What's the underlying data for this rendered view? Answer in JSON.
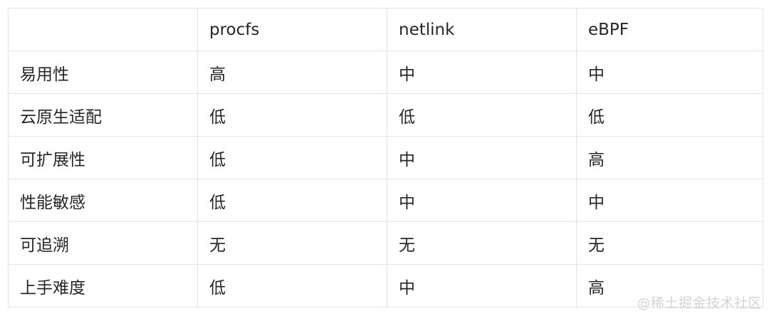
{
  "table": {
    "headers": [
      "",
      "procfs",
      "netlink",
      "eBPF"
    ],
    "rows": [
      {
        "label": "易用性",
        "procfs": "高",
        "netlink": "中",
        "ebpf": "中"
      },
      {
        "label": "云原生适配",
        "procfs": "低",
        "netlink": "低",
        "ebpf": "低"
      },
      {
        "label": "可扩展性",
        "procfs": "低",
        "netlink": "中",
        "ebpf": "高"
      },
      {
        "label": "性能敏感",
        "procfs": "低",
        "netlink": "中",
        "ebpf": "中"
      },
      {
        "label": "可追溯",
        "procfs": "无",
        "netlink": "无",
        "ebpf": "无"
      },
      {
        "label": "上手难度",
        "procfs": "低",
        "netlink": "中",
        "ebpf": "高"
      }
    ]
  },
  "watermark": "@稀土掘金技术社区"
}
